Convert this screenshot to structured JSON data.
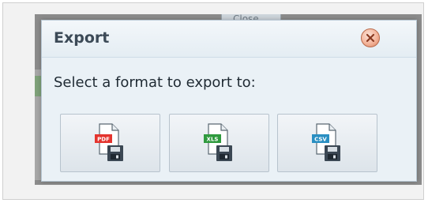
{
  "background": {
    "tab_label": "Close"
  },
  "dialog": {
    "title": "Export",
    "prompt": "Select a format to export to:",
    "close_icon": "close-circle-icon",
    "formats": [
      {
        "label": "PDF",
        "color": "#e4342e",
        "icon": "pdf-file-icon"
      },
      {
        "label": "XLS",
        "color": "#2f9a3e",
        "icon": "xls-file-icon"
      },
      {
        "label": "CSV",
        "color": "#2a8fc2",
        "icon": "csv-file-icon"
      }
    ]
  },
  "colors": {
    "dialog_bg": "#eaf1f6",
    "title_text": "#3c4a57",
    "close_button": "#f3b49a"
  }
}
